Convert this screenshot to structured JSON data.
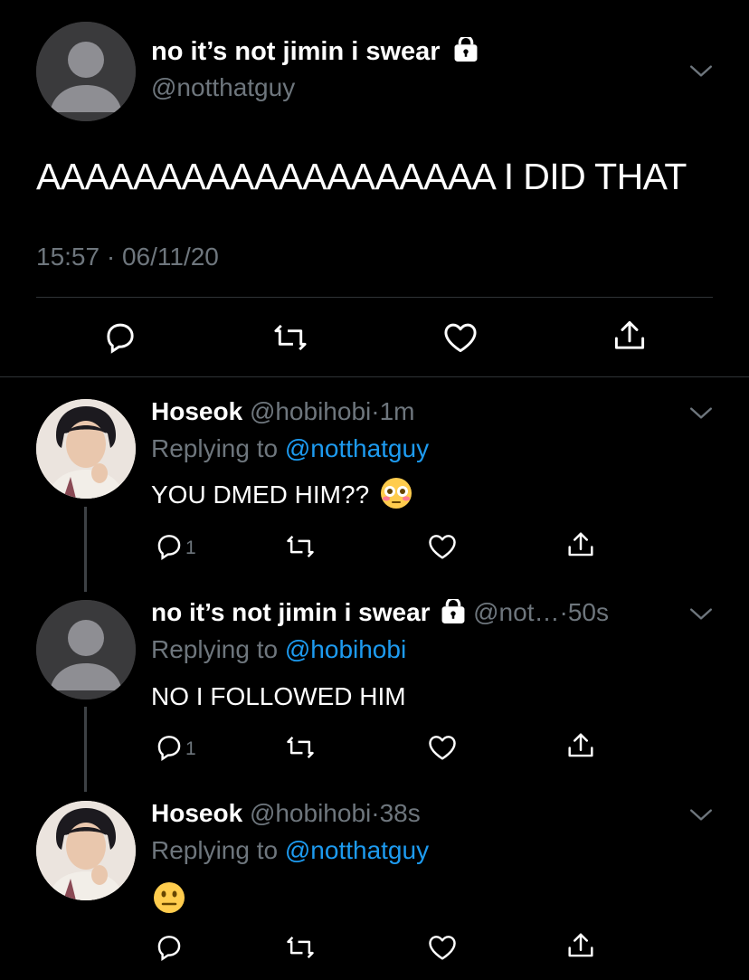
{
  "main_tweet": {
    "display_name": "no it’s not jimin i swear",
    "handle": "@notthatguy",
    "text": "AAAAAAAAAAAAAAAAAAA I DID THAT",
    "timestamp": "15:57 · 06/11/20",
    "icons": [
      "reply-icon",
      "retweet-icon",
      "like-icon",
      "share-icon"
    ]
  },
  "replies": [
    {
      "display_name": "Hoseok",
      "handle": "@hobihobi",
      "time_sep": "·",
      "time": "1m",
      "replying_prefix": "Replying to",
      "replying_to": "@notthatguy",
      "text": "YOU DMED HIM??",
      "emoji": "flushed-face",
      "reply_count": "1"
    },
    {
      "display_name": "no it’s not jimin i swear",
      "handle": "@not…",
      "time_sep": "·",
      "time": "50s",
      "replying_prefix": "Replying to",
      "replying_to": "@hobihobi",
      "text": "NO I FOLLOWED HIM",
      "reply_count": "1"
    },
    {
      "display_name": "Hoseok",
      "handle": "@hobihobi",
      "time_sep": "·",
      "time": "38s",
      "replying_prefix": "Replying to",
      "replying_to": "@notthatguy",
      "emoji": "neutral-face"
    }
  ],
  "colors": {
    "background": "#000000",
    "secondary_text": "#6e767d",
    "link": "#1d9bf0",
    "divider": "#2f3336"
  }
}
